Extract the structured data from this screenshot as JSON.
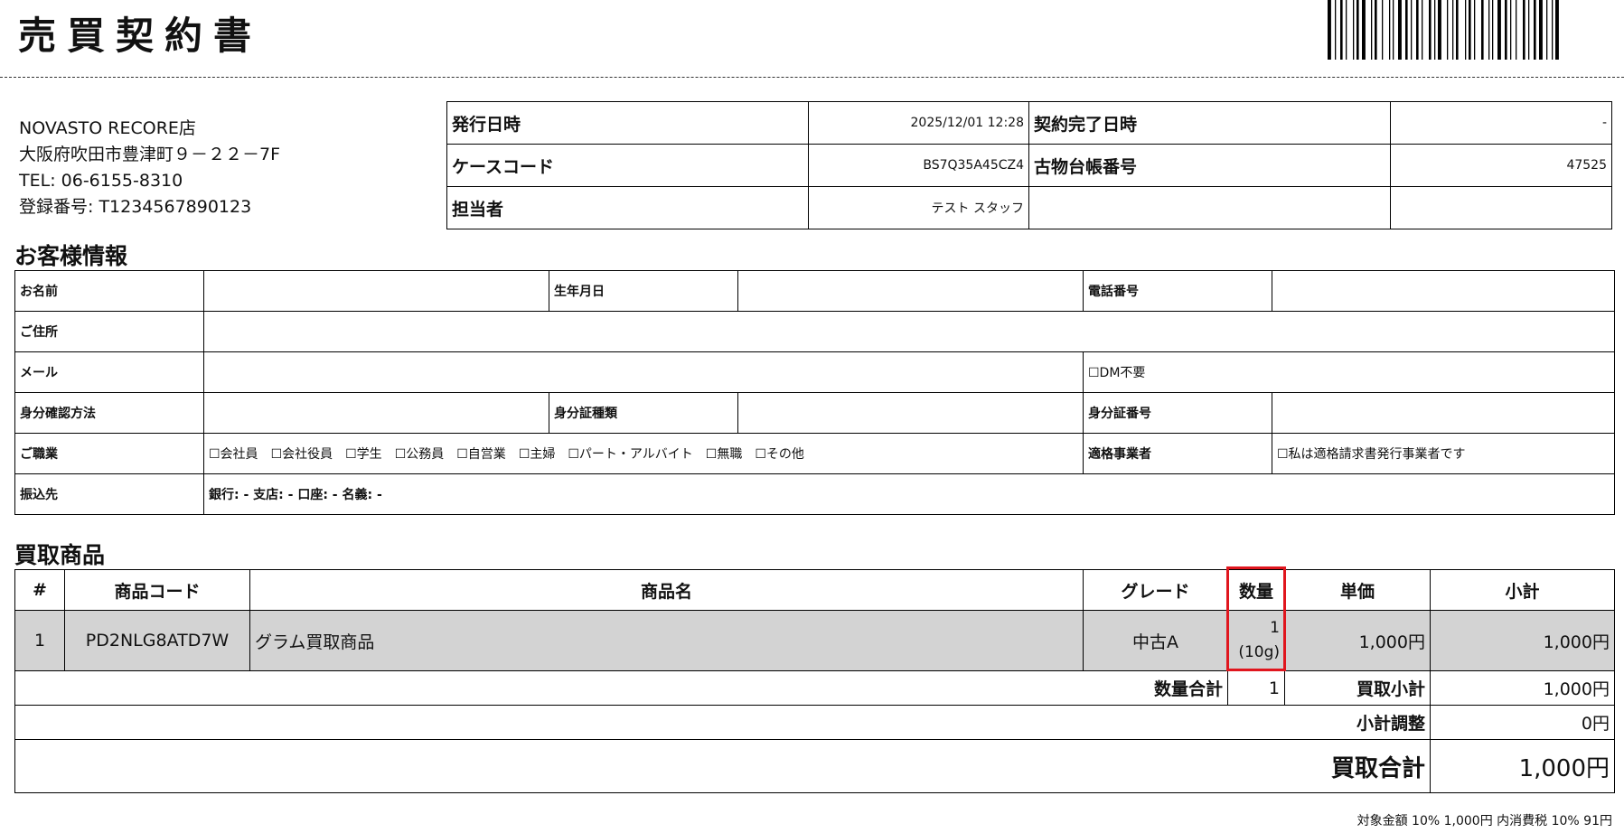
{
  "title": "売買契約書",
  "store": {
    "name": "NOVASTO RECORE店",
    "address": "大阪府吹田市豊津町９－２２－7F",
    "tel": "TEL: 06-6155-8310",
    "registration": "登録番号: T1234567890123"
  },
  "meta": {
    "issue_label": "発行日時",
    "issue_value": "2025/12/01 12:28",
    "complete_label": "契約完了日時",
    "complete_value": "-",
    "case_label": "ケースコード",
    "case_value": "BS7Q35A45CZ4",
    "ledger_label": "古物台帳番号",
    "ledger_value": "47525",
    "staff_label": "担当者",
    "staff_value": "テスト スタッフ"
  },
  "customer": {
    "heading": "お客様情報",
    "name_label": "お名前",
    "birth_label": "生年月日",
    "phone_label": "電話番号",
    "address_label": "ご住所",
    "mail_label": "メール",
    "dm_checkbox": "☐DM不要",
    "id_method_label": "身分確認方法",
    "id_type_label": "身分証種類",
    "id_number_label": "身分証番号",
    "job_label": "ご職業",
    "jobs": [
      "☐会社員",
      "☐会社役員",
      "☐学生",
      "☐公務員",
      "☐自営業",
      "☐主婦",
      "☐パート・アルバイト",
      "☐無職",
      "☐その他"
    ],
    "qualified_label": "適格事業者",
    "qualified_checkbox": "☐私は適格請求書発行事業者です",
    "bank_label": "振込先",
    "bank_value": "銀行: - 支店: - 口座: - 名義: -"
  },
  "items": {
    "heading": "買取商品",
    "headers": {
      "num": "#",
      "code": "商品コード",
      "name": "商品名",
      "grade": "グレード",
      "qty": "数量",
      "unit_price": "単価",
      "subtotal": "小計"
    },
    "rows": [
      {
        "num": "1",
        "code": "PD2NLG8ATD7W",
        "name": "グラム買取商品",
        "grade": "中古A",
        "qty": "1",
        "weight": "(10g)",
        "unit_price": "1,000円",
        "subtotal": "1,000円"
      }
    ],
    "qty_total_label": "数量合計",
    "qty_total": "1",
    "buy_subtotal_label": "買取小計",
    "buy_subtotal": "1,000円",
    "adjust_label": "小計調整",
    "adjust_value": "0円",
    "total_label": "買取合計",
    "total_value": "1,000円"
  },
  "tax_note": "対象金額 10% 1,000円 内消費税 10% 91円",
  "highlight_color": "#e0161e"
}
